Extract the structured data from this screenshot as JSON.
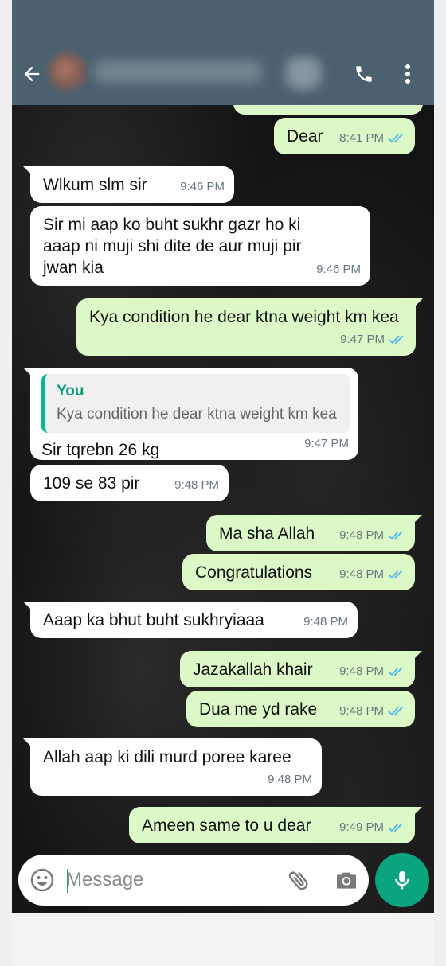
{
  "header": {
    "contact_name": "",
    "icons": [
      "back-arrow-icon",
      "video-call-icon",
      "phone-icon",
      "more-vert-icon"
    ]
  },
  "messages": [
    {
      "dir": "out",
      "text": "Dear",
      "time": "8:41 PM",
      "status": "read"
    },
    {
      "dir": "in",
      "text": "Wlkum slm sir",
      "time": "9:46 PM"
    },
    {
      "dir": "in",
      "text": "Sir mi aap ko buht sukhr gazr  ho ki aaap ni muji shi dite de aur muji pir jwan kia",
      "time": "9:46 PM"
    },
    {
      "dir": "out",
      "text": "Kya condition he dear ktna weight km kea",
      "time": "9:47 PM",
      "status": "read"
    },
    {
      "dir": "in",
      "quote_author": "You",
      "quote_text": "Kya condition he dear ktna weight km kea",
      "text": "Sir tqrebn  26 kg",
      "time": "9:47 PM"
    },
    {
      "dir": "in",
      "text": "109 se 83  pir",
      "time": "9:48 PM"
    },
    {
      "dir": "out",
      "text": "Ma sha Allah",
      "time": "9:48 PM",
      "status": "read"
    },
    {
      "dir": "out",
      "text": "Congratulations",
      "time": "9:48 PM",
      "status": "read"
    },
    {
      "dir": "in",
      "text": "Aaap ka bhut buht sukhryiaaa",
      "time": "9:48 PM"
    },
    {
      "dir": "out",
      "text": "Jazakallah khair",
      "time": "9:48 PM",
      "status": "read"
    },
    {
      "dir": "out",
      "text": "Dua me yd rake",
      "time": "9:48 PM",
      "status": "read"
    },
    {
      "dir": "in",
      "text": "Allah aap ki dili murd poree karee",
      "time": "9:48 PM"
    },
    {
      "dir": "out",
      "text": "Ameen same to u dear",
      "time": "9:49 PM",
      "status": "read"
    }
  ],
  "input": {
    "placeholder": "Message",
    "value": ""
  },
  "colors": {
    "header": "#4b6170",
    "outgoing_bubble": "#dcf8c6",
    "incoming_bubble": "#ffffff",
    "accent": "#0aa57e",
    "read_ticks": "#4fb6ec"
  }
}
